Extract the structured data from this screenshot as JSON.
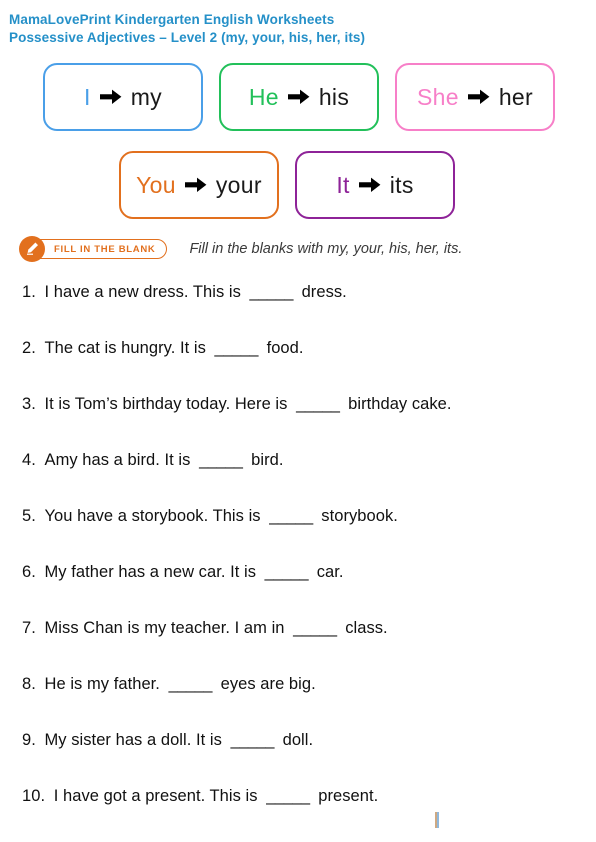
{
  "header": {
    "line1": "MamaLovePrint Kindergarten English Worksheets",
    "line2": "Possessive Adjectives – Level 2 (my, your, his, her, its)",
    "color": "#2590c8"
  },
  "pronoun_boxes": {
    "row1": [
      {
        "subject": "I",
        "possessive": "my",
        "color": "#4a9fe8",
        "arrow": "right-arrow"
      },
      {
        "subject": "He",
        "possessive": "his",
        "color": "#22c05a",
        "arrow": "right-arrow"
      },
      {
        "subject": "She",
        "possessive": "her",
        "color": "#f77fc8",
        "arrow": "right-arrow"
      }
    ],
    "row2": [
      {
        "subject": "You",
        "possessive": "your",
        "color": "#e2701e",
        "arrow": "right-arrow"
      },
      {
        "subject": "It",
        "possessive": "its",
        "color": "#8e2398",
        "arrow": "right-arrow"
      }
    ]
  },
  "instruction": {
    "badge_label": "FILL IN THE BLANK",
    "badge_icon": "pencil-icon",
    "badge_color": "#e2701e",
    "text": "Fill in the blanks with my, your, his, her, its."
  },
  "questions": [
    {
      "number": "1.",
      "before": "I have a new dress. This is",
      "blank": "_____",
      "after": "dress."
    },
    {
      "number": "2.",
      "before": "The cat is hungry. It is",
      "blank": "_____",
      "after": "food."
    },
    {
      "number": "3.",
      "before": "It is Tom’s birthday today. Here is",
      "blank": "_____",
      "after": "birthday cake."
    },
    {
      "number": "4.",
      "before": "Amy has a bird. It is",
      "blank": "_____",
      "after": "bird."
    },
    {
      "number": "5.",
      "before": "You have a storybook. This is",
      "blank": "_____",
      "after": "storybook."
    },
    {
      "number": "6.",
      "before": "My father has a new car. It is",
      "blank": "_____",
      "after": "car."
    },
    {
      "number": "7.",
      "before": "Miss Chan is my teacher. I am in",
      "blank": "_____",
      "after": "class."
    },
    {
      "number": "8.",
      "before": "He is my father.",
      "blank": "_____",
      "after": "eyes are big."
    },
    {
      "number": "9.",
      "before": "My sister has a doll. It is",
      "blank": "_____",
      "after": "doll."
    },
    {
      "number": "10.",
      "before": "I have got a present. This is",
      "blank": "_____",
      "after": "present."
    }
  ]
}
